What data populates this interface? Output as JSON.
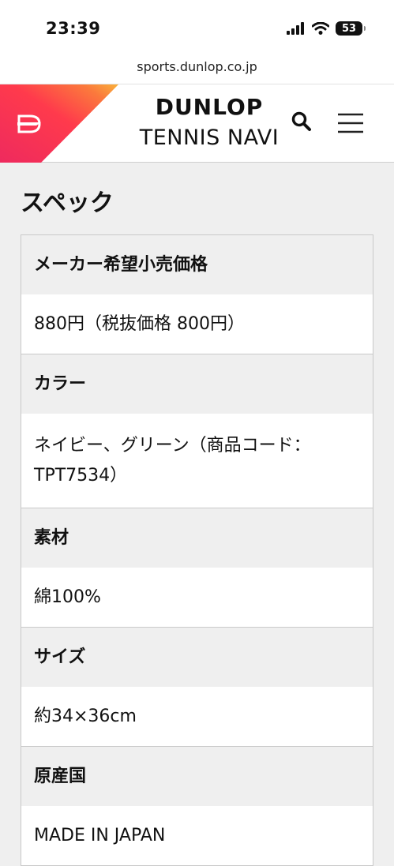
{
  "status_bar": {
    "time": "23:39",
    "battery": "53"
  },
  "browser": {
    "url": "sports.dunlop.co.jp"
  },
  "header": {
    "brand": "DUNLOP",
    "subtitle": "TENNIS NAVI",
    "logo_icon": "dunlop-flying-d-logo",
    "search_icon": "search-icon",
    "menu_icon": "hamburger-menu-icon",
    "accent_colors": [
      "#ee2a5e",
      "#ff3a4c",
      "#f9a23b"
    ]
  },
  "section": {
    "title": "スペック"
  },
  "specs": [
    {
      "label": "メーカー希望小売価格",
      "value": "880円（税抜価格 800円）"
    },
    {
      "label": "カラー",
      "value": "ネイビー、グリーン（商品コード：TPT7534）"
    },
    {
      "label": "素材",
      "value": "綿100%"
    },
    {
      "label": "サイズ",
      "value": "約34×36cm"
    },
    {
      "label": "原産国",
      "value": "MADE IN JAPAN"
    }
  ]
}
